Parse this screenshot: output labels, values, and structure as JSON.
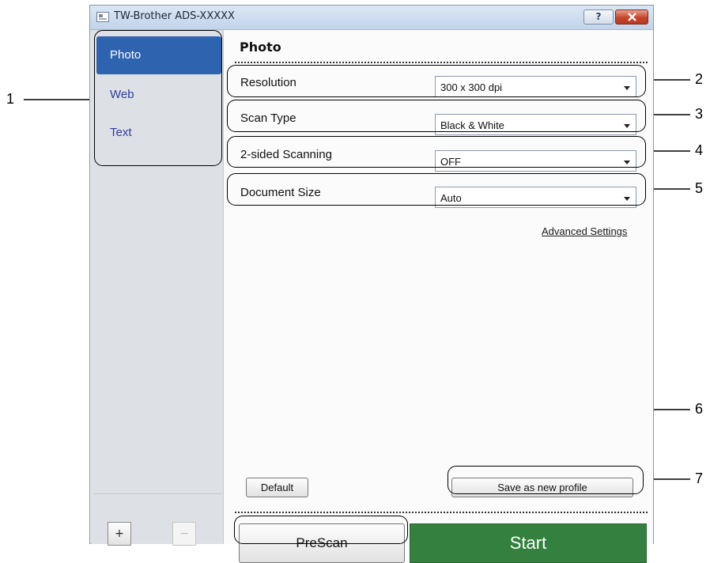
{
  "window": {
    "title": "TW-Brother ADS-XXXXX",
    "help_label": "?"
  },
  "sidebar": {
    "items": [
      {
        "label": "Photo",
        "active": true
      },
      {
        "label": "Web",
        "active": false
      },
      {
        "label": "Text",
        "active": false
      }
    ],
    "add_label": "+",
    "remove_label": "−"
  },
  "main": {
    "heading": "Photo",
    "settings": [
      {
        "label": "Resolution",
        "value": "300 x 300 dpi"
      },
      {
        "label": "Scan Type",
        "value": "Black & White"
      },
      {
        "label": "2-sided Scanning",
        "value": "OFF"
      },
      {
        "label": "Document Size",
        "value": "Auto"
      }
    ],
    "advanced_link": "Advanced Settings",
    "default_label": "Default",
    "save_profile_label": "Save as new profile",
    "prescan_label": "PreScan",
    "start_label": "Start"
  },
  "callouts": [
    "1",
    "2",
    "3",
    "4",
    "5",
    "6",
    "7"
  ],
  "colors": {
    "accent": "#2e63b0",
    "start": "#34803e",
    "link": "#2c3b9c"
  }
}
